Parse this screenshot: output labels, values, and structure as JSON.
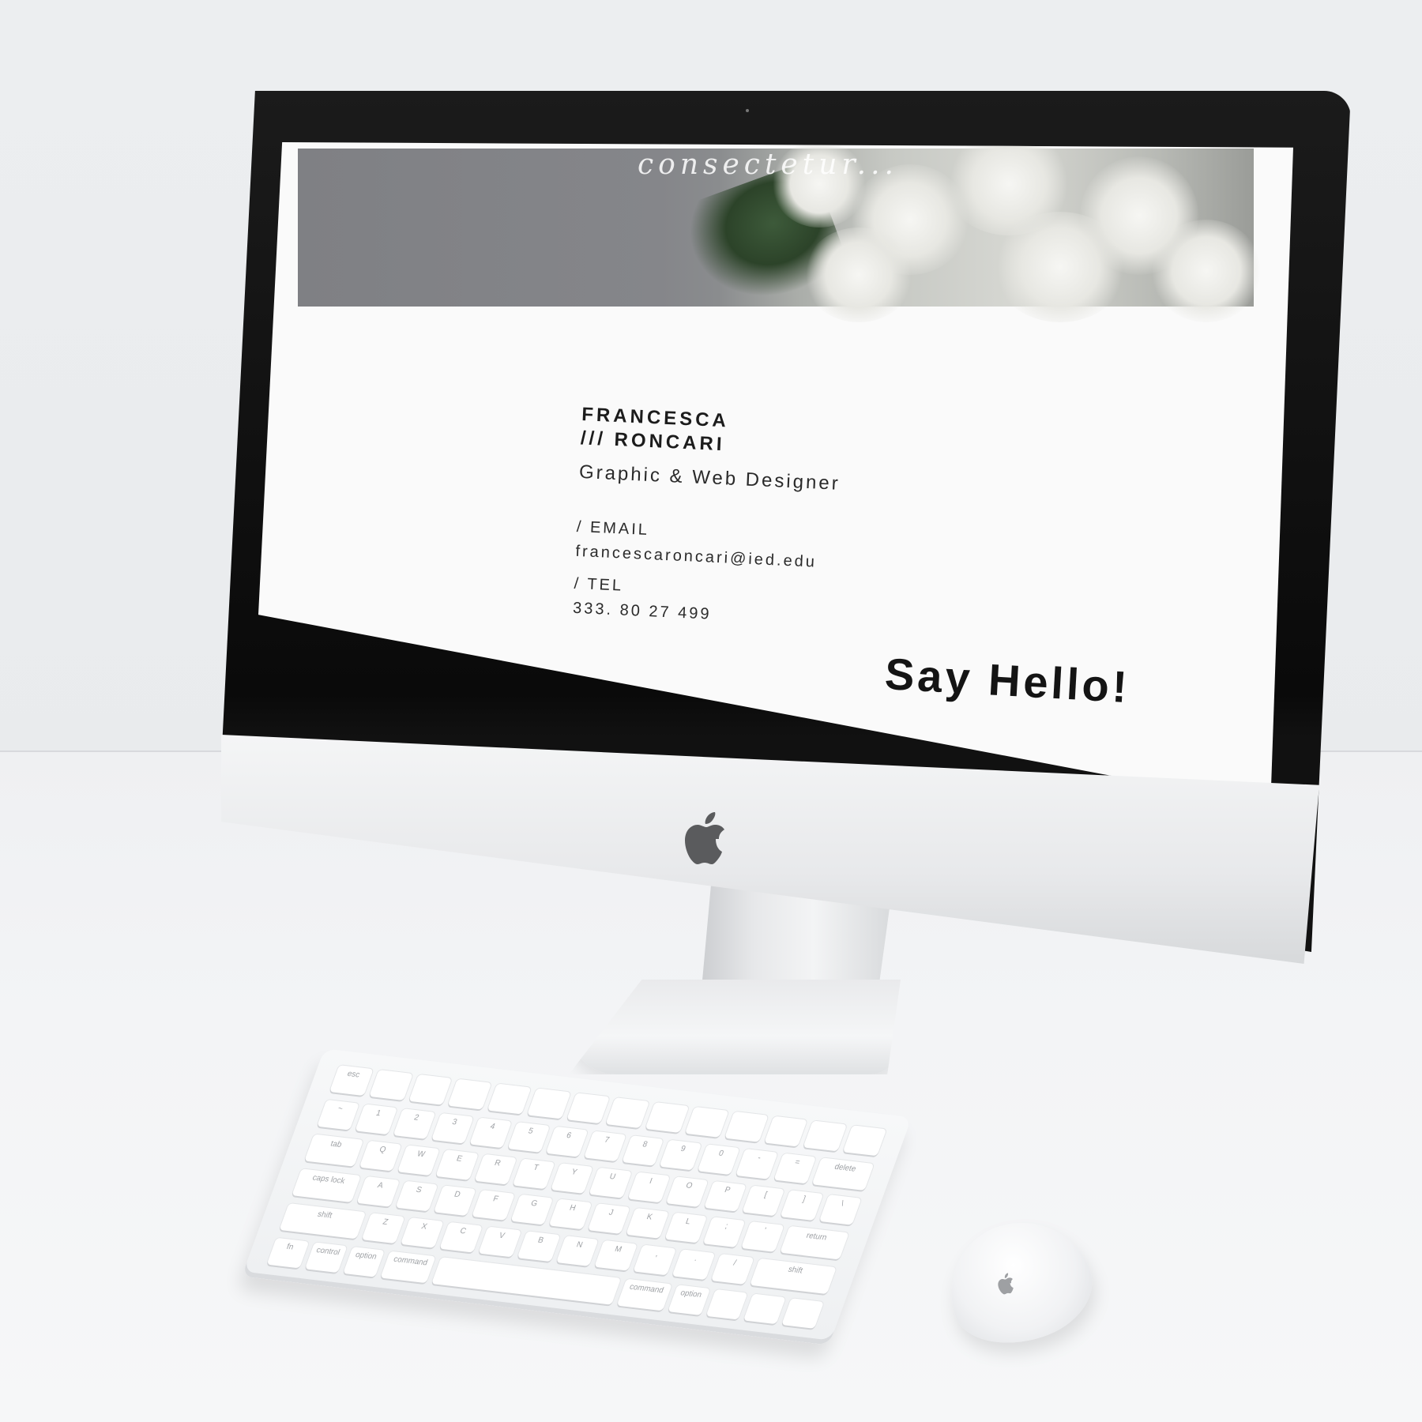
{
  "screen": {
    "hero": {
      "script_text": "consectetur..."
    },
    "contact": {
      "name_line_1": "FRANCESCA",
      "name_line_2": "/// RONCARI",
      "role": "Graphic & Web Designer",
      "email_label": "/ EMAIL",
      "email_value": "francescaroncari@ied.edu",
      "tel_label": "/ TEL",
      "tel_value": "333. 80 27 499"
    },
    "cta": "Say Hello!"
  },
  "keyboard": {
    "row_labels": [
      [
        "esc",
        "",
        "",
        "",
        "",
        "",
        "",
        "",
        "",
        "",
        "",
        "",
        "",
        ""
      ],
      [
        "~",
        "1",
        "2",
        "3",
        "4",
        "5",
        "6",
        "7",
        "8",
        "9",
        "0",
        "-",
        "=",
        "delete"
      ],
      [
        "tab",
        "Q",
        "W",
        "E",
        "R",
        "T",
        "Y",
        "U",
        "I",
        "O",
        "P",
        "[",
        "]",
        "\\"
      ],
      [
        "caps lock",
        "A",
        "S",
        "D",
        "F",
        "G",
        "H",
        "J",
        "K",
        "L",
        ";",
        "'",
        "return"
      ],
      [
        "shift",
        "Z",
        "X",
        "C",
        "V",
        "B",
        "N",
        "M",
        ",",
        ".",
        "/",
        "shift"
      ],
      [
        "fn",
        "control",
        "option",
        "command",
        "",
        "command",
        "option",
        "",
        "",
        ""
      ]
    ]
  },
  "colors": {
    "screen_bg": "#fafafa",
    "text": "#1c1c1c",
    "bezel": "#0a0a0a",
    "aluminum": "#e8e9eb"
  },
  "icons": {
    "monitor_logo": "apple-logo-icon",
    "mouse_logo": "apple-logo-icon"
  }
}
